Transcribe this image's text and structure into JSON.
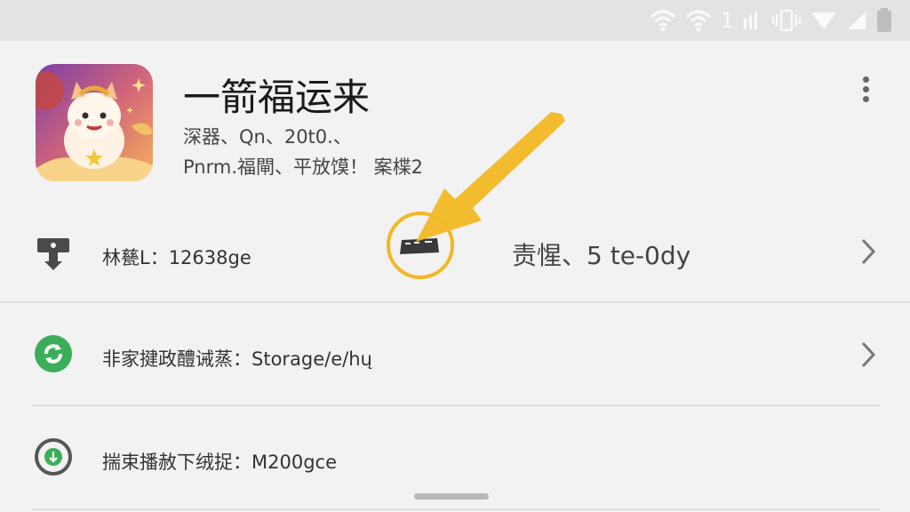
{
  "status_bar": {
    "signal_text": "1",
    "icons": [
      "wifi-icon",
      "wifi-icon",
      "signal-icon",
      "vibrate-icon",
      "cell-signal-icon",
      "battery-icon"
    ]
  },
  "app": {
    "title": "一箭福运来",
    "subtitle_line1": "深器、Qn、20t0.、",
    "subtitle_line2": "Pnrm.福閘、平放馍！ 案楪2",
    "icon": "mascot-app-icon"
  },
  "rows": [
    {
      "label": "林甆L：12638ge",
      "value": "责惺、5 te-0dy",
      "icon": "download-device-icon"
    },
    {
      "label": "非家揵政醴诫蒸：Storage/e/hų",
      "icon": "recycle-icon"
    },
    {
      "label": "揣束播赦下绒捉：M200gce",
      "icon": "install-circle-icon"
    }
  ],
  "colors": {
    "accent": "#f2b824",
    "green": "#3cae5a",
    "background": "#f2f2f2"
  }
}
